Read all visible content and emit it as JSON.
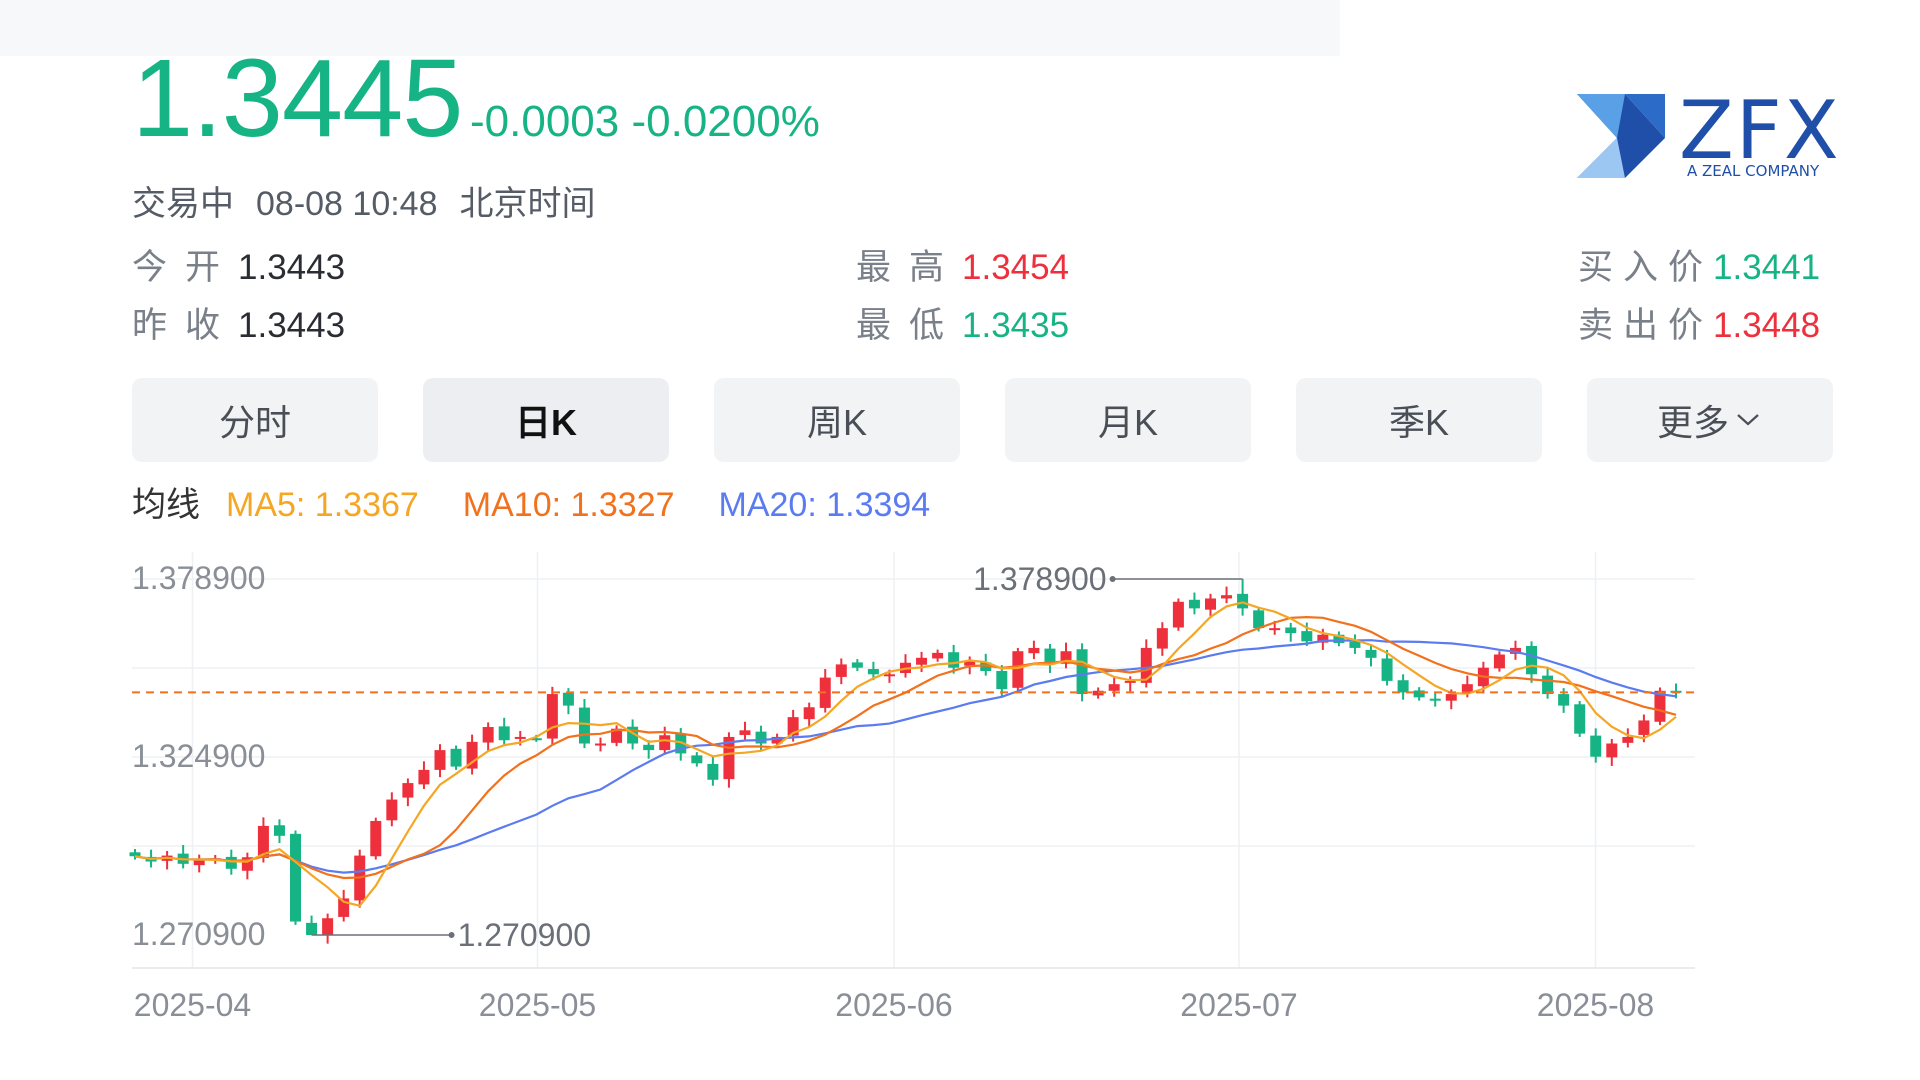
{
  "quote": {
    "price": "1.3445",
    "change": "-0.0003",
    "change_pct": "-0.0200%",
    "status": "交易中",
    "datetime": "08-08 10:48",
    "timezone": "北京时间",
    "open_label": "今开",
    "open_value": "1.3443",
    "prev_close_label": "昨收",
    "prev_close_value": "1.3443",
    "high_label": "最高",
    "high_value": "1.3454",
    "low_label": "最低",
    "low_value": "1.3435",
    "bid_label": "买入价",
    "bid_value": "1.3441",
    "ask_label": "卖出价",
    "ask_value": "1.3448"
  },
  "tabs": [
    "分时",
    "日K",
    "周K",
    "月K",
    "季K",
    "更多"
  ],
  "active_tab": "日K",
  "moving_averages": {
    "label": "均线",
    "ma5": "MA5: 1.3367",
    "ma10": "MA10: 1.3327",
    "ma20": "MA20: 1.3394"
  },
  "logo": {
    "text": "ZFX",
    "subtitle": "A ZEAL COMPANY"
  },
  "colors": {
    "up": "#ee2f3c",
    "down": "#16b484",
    "ma5": "#f5a623",
    "ma10": "#f2711c",
    "ma20": "#5b7bf0",
    "current_line": "#f2711c",
    "logo": "#1f4fa8"
  },
  "chart_data": {
    "type": "candlestick",
    "y_ticks": [
      "1.378900",
      "1.324900",
      "1.270900"
    ],
    "x_ticks": [
      "2025-04",
      "2025-05",
      "2025-06",
      "2025-07",
      "2025-08"
    ],
    "ylim": [
      1.2609,
      1.3871
    ],
    "max_label": "1.378900",
    "min_label": "1.270900",
    "current_value": 1.3445,
    "days": [
      "2025-03-27",
      "2025-03-28",
      "2025-03-31",
      "2025-04-01",
      "2025-04-02",
      "2025-04-03",
      "2025-04-04",
      "2025-04-07",
      "2025-04-08",
      "2025-04-09",
      "2025-04-10",
      "2025-04-11",
      "2025-04-14",
      "2025-04-15",
      "2025-04-16",
      "2025-04-17",
      "2025-04-18",
      "2025-04-21",
      "2025-04-22",
      "2025-04-23",
      "2025-04-24",
      "2025-04-25",
      "2025-04-28",
      "2025-04-29",
      "2025-04-30",
      "2025-05-01",
      "2025-05-02",
      "2025-05-05",
      "2025-05-06",
      "2025-05-07",
      "2025-05-08",
      "2025-05-09",
      "2025-05-12",
      "2025-05-13",
      "2025-05-14",
      "2025-05-15",
      "2025-05-16",
      "2025-05-19",
      "2025-05-20",
      "2025-05-21",
      "2025-05-22",
      "2025-05-23",
      "2025-05-26",
      "2025-05-27",
      "2025-05-28",
      "2025-05-29",
      "2025-05-30",
      "2025-06-02",
      "2025-06-03",
      "2025-06-04",
      "2025-06-05",
      "2025-06-06",
      "2025-06-09",
      "2025-06-10",
      "2025-06-11",
      "2025-06-12",
      "2025-06-13",
      "2025-06-16",
      "2025-06-17",
      "2025-06-18",
      "2025-06-19",
      "2025-06-20",
      "2025-06-23",
      "2025-06-24",
      "2025-06-25",
      "2025-06-26",
      "2025-06-27",
      "2025-06-30",
      "2025-07-01",
      "2025-07-02",
      "2025-07-03",
      "2025-07-04",
      "2025-07-07",
      "2025-07-08",
      "2025-07-09",
      "2025-07-10",
      "2025-07-11",
      "2025-07-14",
      "2025-07-15",
      "2025-07-16",
      "2025-07-17",
      "2025-07-18",
      "2025-07-21",
      "2025-07-22",
      "2025-07-23",
      "2025-07-24",
      "2025-07-25",
      "2025-07-28",
      "2025-07-29",
      "2025-07-30",
      "2025-07-31",
      "2025-08-01",
      "2025-08-04",
      "2025-08-05",
      "2025-08-06",
      "2025-08-07",
      "2025-08-08"
    ],
    "closes": [
      1.2948,
      1.2932,
      1.295,
      1.2925,
      1.2935,
      1.2942,
      1.291,
      1.2945,
      1.304,
      1.301,
      1.275,
      1.2709,
      1.276,
      1.282,
      1.295,
      1.3055,
      1.312,
      1.317,
      1.321,
      1.327,
      1.322,
      1.3295,
      1.334,
      1.33,
      1.331,
      1.3305,
      1.344,
      1.3405,
      1.329,
      1.329,
      1.3335,
      1.329,
      1.327,
      1.3315,
      1.326,
      1.323,
      1.318,
      1.331,
      1.333,
      1.329,
      1.331,
      1.337,
      1.34,
      1.349,
      1.353,
      1.352,
      1.35,
      1.35,
      1.3535,
      1.355,
      1.3565,
      1.352,
      1.354,
      1.351,
      1.3455,
      1.357,
      1.358,
      1.353,
      1.357,
      1.344,
      1.345,
      1.347,
      1.348,
      1.358,
      1.364,
      1.372,
      1.37,
      1.373,
      1.374,
      1.37,
      1.364,
      1.364,
      1.3625,
      1.36,
      1.362,
      1.3595,
      1.358,
      1.355,
      1.348,
      1.3445,
      1.343,
      1.342,
      1.344,
      1.347,
      1.352,
      1.356,
      1.358,
      1.35,
      1.344,
      1.3405,
      1.332,
      1.325,
      1.329,
      1.331,
      1.336,
      1.345,
      1.3445
    ]
  }
}
